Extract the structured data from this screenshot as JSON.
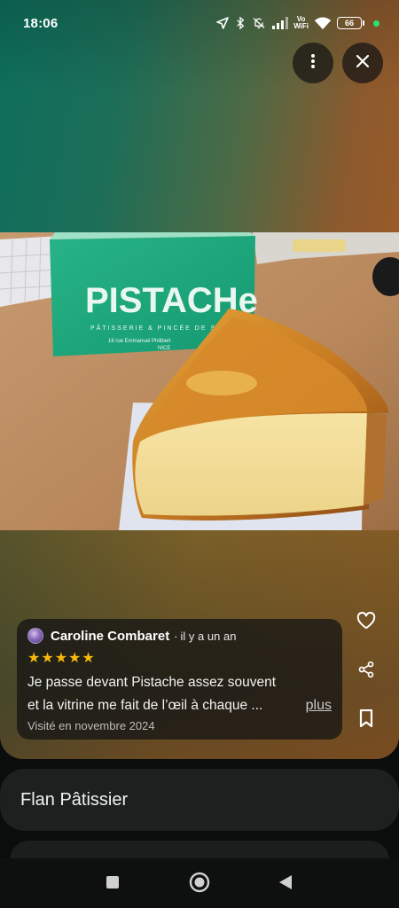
{
  "status_bar": {
    "time": "18:06",
    "vowifi_top": "Vo",
    "vowifi_bottom": "WiFi",
    "battery": "66",
    "icons": [
      "location-arrow-icon",
      "bluetooth-icon",
      "bell-off-icon",
      "signal-icon",
      "vowifi-icon",
      "wifi-icon",
      "battery-icon"
    ]
  },
  "top_actions": {
    "more_icon": "more-vert-icon",
    "close_icon": "close-icon"
  },
  "photo": {
    "box_brand": "PISTACHe",
    "box_subtitle": "PÂTISSERIE & PINCÉE DE SEL",
    "box_address_1": "16 rue Emmanuel Philibert",
    "box_address_2": "NICE"
  },
  "review": {
    "reviewer": "Caroline Combaret",
    "separator": "·",
    "when": "il y a un an",
    "rating": 5,
    "stars": [
      "★",
      "★",
      "★",
      "★",
      "★"
    ],
    "text_line1": "Je passe devant Pistache assez souvent",
    "text_line2": "et la vitrine me fait de l’œil à chaque ...",
    "more_label": "plus",
    "visited": "Visité en novembre 2024"
  },
  "side_actions": {
    "like_icon": "heart-icon",
    "share_icon": "share-icon",
    "save_icon": "bookmark-icon"
  },
  "dish": {
    "title": "Flan Pâtissier"
  },
  "colors": {
    "star": "#f6b90c",
    "box_green": "#1fa879",
    "status_dot": "#2ee06a"
  }
}
